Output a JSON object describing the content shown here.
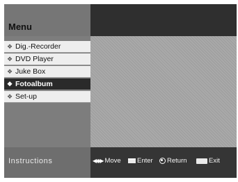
{
  "menu": {
    "title": "Menu",
    "items": [
      {
        "label": "Dig.-Recorder",
        "icon": "diamond-bullet-icon",
        "selected": false
      },
      {
        "label": "DVD Player",
        "icon": "diamond-bullet-icon",
        "selected": false
      },
      {
        "label": "Juke Box",
        "icon": "diamond-bullet-icon",
        "selected": false
      },
      {
        "label": "Fotoalbum",
        "icon": "diamond-bullet-icon",
        "selected": true
      },
      {
        "label": "Set-up",
        "icon": "diamond-bullet-icon",
        "selected": false
      }
    ]
  },
  "footer": {
    "label": "Instructions",
    "hints": {
      "move": {
        "label": "Move",
        "icon": "four-way-arrows-icon"
      },
      "enter": {
        "label": "Enter",
        "icon": "enter-key-icon"
      },
      "return": {
        "label": "Return",
        "icon": "return-circle-icon"
      },
      "exit": {
        "label": "Exit",
        "icon": "menu-key-icon"
      }
    }
  },
  "colors": {
    "selected_bg": "#2a2a2a",
    "item_bg": "#eeeeee",
    "panel_bg": "#7d7d7d",
    "content_bg": "#a9a9a9"
  }
}
